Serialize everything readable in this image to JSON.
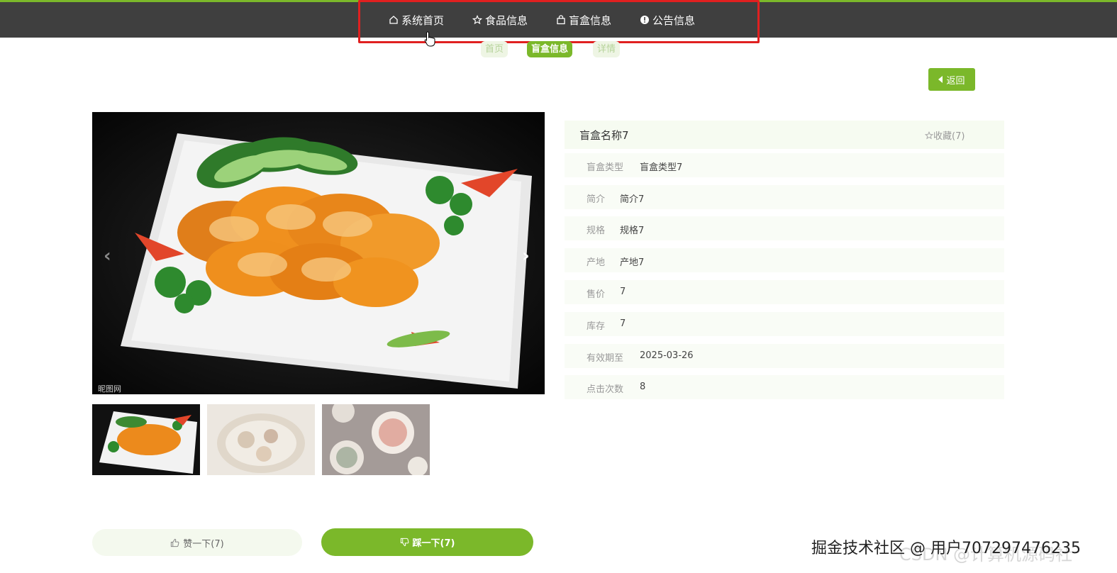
{
  "nav": {
    "items": [
      {
        "label": "系统首页",
        "icon": "home-icon"
      },
      {
        "label": "食品信息",
        "icon": "star-icon"
      },
      {
        "label": "盲盒信息",
        "icon": "bag-icon"
      },
      {
        "label": "公告信息",
        "icon": "info-icon"
      }
    ]
  },
  "breadcrumb": {
    "items": [
      "首页",
      "盲盒信息",
      "详情"
    ]
  },
  "back_button": "返回",
  "detail": {
    "title": "盲盒名称7",
    "favorite": "收藏(7)",
    "rows": [
      {
        "label": "盲盒类型",
        "value": "盲盒类型7"
      },
      {
        "label": "简介",
        "value": "简介7"
      },
      {
        "label": "规格",
        "value": "规格7"
      },
      {
        "label": "产地",
        "value": "产地7"
      },
      {
        "label": "售价",
        "value": "7"
      },
      {
        "label": "库存",
        "value": "7"
      },
      {
        "label": "有效期至",
        "value": "2025-03-26"
      },
      {
        "label": "点击次数",
        "value": "8"
      }
    ]
  },
  "actions": {
    "like": "赞一下(7)",
    "dislike": "踩一下(7)"
  },
  "watermark": {
    "text": "掘金技术社区 @ 用户707297476235",
    "text2": "CSDN @计算机源码社"
  },
  "colors": {
    "accent": "#7bb82a",
    "navbar": "#3f3f3f",
    "highlight": "#e02020"
  }
}
